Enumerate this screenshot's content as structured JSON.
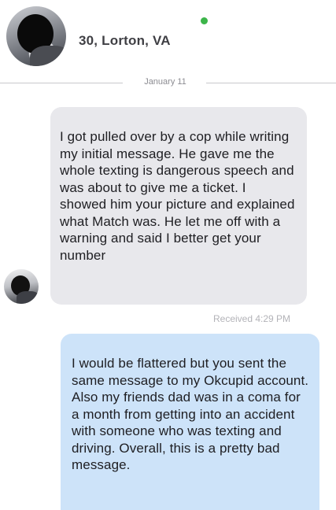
{
  "header": {
    "profile_info": "30, Lorton, VA",
    "status": "online",
    "status_color": "#3cb54a"
  },
  "conversation": {
    "date_label": "January 11",
    "messages": [
      {
        "direction": "received",
        "text": "I got pulled over by a cop while writing my initial message. He gave me the whole texting is dangerous speech and was about to give me a ticket. I showed him your picture and explained what Match was. He let me off with a warning and said I better get your number",
        "meta": "Received 4:29 PM",
        "bubble_color": "#e8e8ec"
      },
      {
        "direction": "sent",
        "text": "I would be flattered but you sent the same message to my Okcupid account. Also my friends dad was in a coma for a month from getting into an accident with someone who was texting and driving. Overall, this is a pretty bad message.",
        "bubble_color": "#cde3f9"
      }
    ]
  }
}
